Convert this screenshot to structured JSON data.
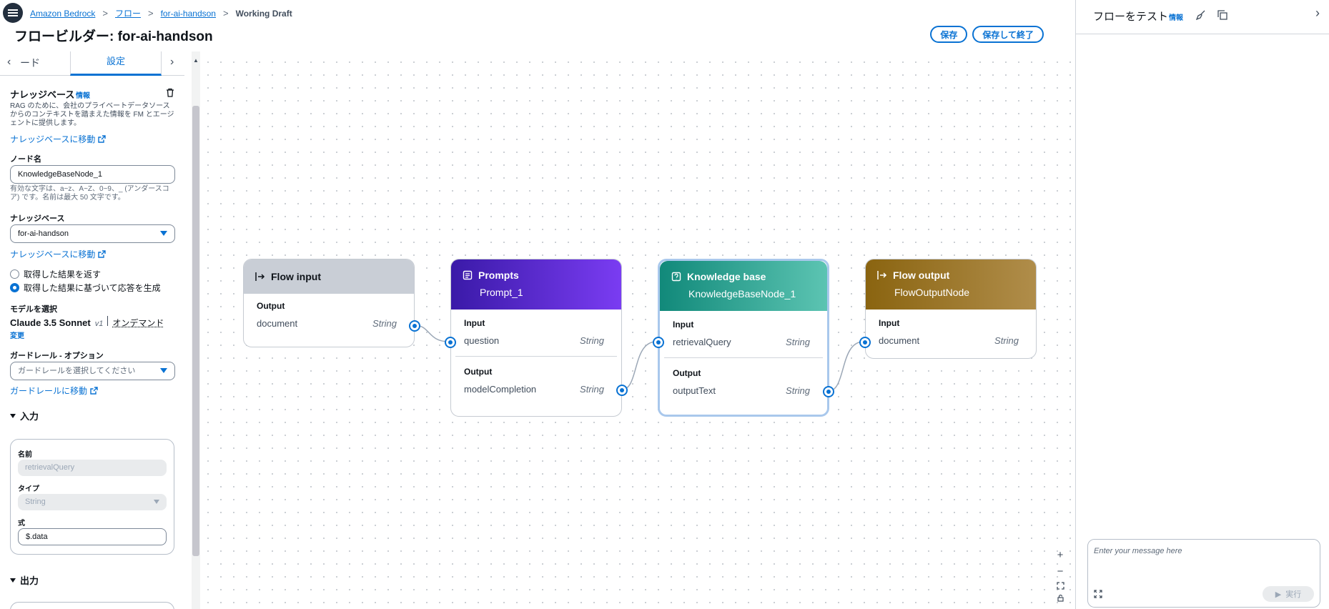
{
  "breadcrumb": {
    "items": [
      "Amazon Bedrock",
      "フロー",
      "for-ai-handson"
    ],
    "current": "Working Draft"
  },
  "page_title": "フロービルダー: for-ai-handson",
  "header_actions": {
    "save": "保存",
    "save_exit": "保存して終了"
  },
  "left_panel": {
    "tabs": {
      "node": "ード",
      "settings": "設定"
    },
    "kb_section": {
      "title": "ナレッジベース",
      "info": "情報",
      "description": "RAG のために、会社のプライベートデータソースからのコンテキストを踏まえた情報を FM とエージェントに提供します。",
      "goto_link": "ナレッジベースに移動"
    },
    "node_name": {
      "label": "ノード名",
      "value": "KnowledgeBaseNode_1",
      "hint": "有効な文字は、a~z、A~Z、0~9、_ (アンダースコア) です。名前は最大 50 文字です。"
    },
    "kb_select": {
      "label": "ナレッジベース",
      "value": "for-ai-handson",
      "goto_link": "ナレッジベースに移動"
    },
    "radio": {
      "return_results": "取得した結果を返す",
      "generate_response": "取得した結果に基づいて応答を生成"
    },
    "model": {
      "label": "モデルを選択",
      "name": "Claude 3.5 Sonnet",
      "version": "v1",
      "mode": "オンデマンド",
      "change": "変更"
    },
    "guardrail": {
      "label": "ガードレール - オプション",
      "placeholder": "ガードレールを選択してください",
      "goto_link": "ガードレールに移動"
    },
    "input_section": {
      "title": "入力",
      "name_label": "名前",
      "name_value": "retrievalQuery",
      "type_label": "タイプ",
      "type_value": "String",
      "expr_label": "式",
      "expr_value": "$.data"
    },
    "output_section": {
      "title": "出力"
    }
  },
  "canvas": {
    "nodes": {
      "flow_input": {
        "title": "Flow input",
        "output_label": "Output",
        "output_name": "document",
        "output_type": "String"
      },
      "prompts": {
        "title": "Prompts",
        "subtitle": "Prompt_1",
        "input_label": "Input",
        "input_name": "question",
        "input_type": "String",
        "output_label": "Output",
        "output_name": "modelCompletion",
        "output_type": "String"
      },
      "knowledge_base": {
        "title": "Knowledge base",
        "subtitle": "KnowledgeBaseNode_1",
        "input_label": "Input",
        "input_name": "retrievalQuery",
        "input_type": "String",
        "output_label": "Output",
        "output_name": "outputText",
        "output_type": "String"
      },
      "flow_output": {
        "title": "Flow output",
        "subtitle": "FlowOutputNode",
        "input_label": "Input",
        "input_name": "document",
        "input_type": "String"
      }
    },
    "zoom": {
      "in": "+",
      "out": "−"
    }
  },
  "right_panel": {
    "title": "フローをテスト",
    "info": "情報",
    "chat_placeholder": "Enter your message here",
    "run_button": "実行"
  },
  "colors": {
    "accent": "#0972d3",
    "prompts_header": "#5b2bd6",
    "kb_header": "#1a9a8a",
    "output_header": "#9a7322",
    "input_header": "#c9ced6"
  }
}
